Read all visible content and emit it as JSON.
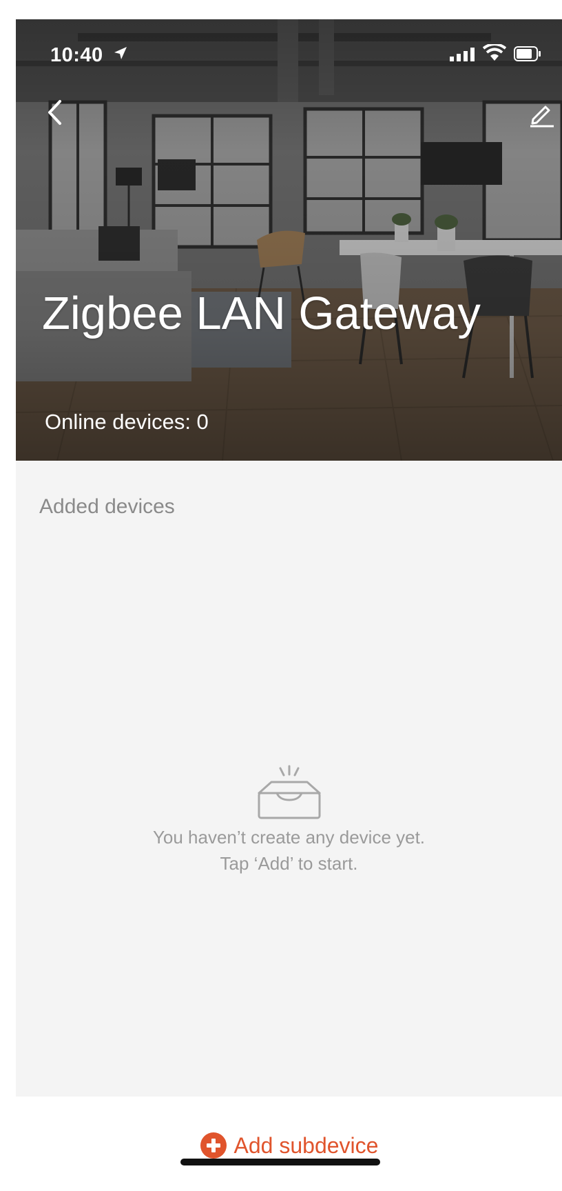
{
  "status_bar": {
    "time": "10:40"
  },
  "header": {
    "title": "Zigbee LAN Gateway",
    "online_devices": "Online devices: 0",
    "back_icon": "chevron-left-icon",
    "edit_icon": "pencil-icon"
  },
  "devices": {
    "section_label": "Added devices",
    "empty_icon": "empty-tray-icon",
    "empty_line1": "You haven’t create any device yet.",
    "empty_line2": "Tap ‘Add’ to start."
  },
  "footer": {
    "add_label": "Add subdevice",
    "add_icon": "plus-circle-icon"
  },
  "colors": {
    "accent": "#e0542c",
    "background": "#f4f4f4",
    "muted_text": "#9a9a9a"
  }
}
